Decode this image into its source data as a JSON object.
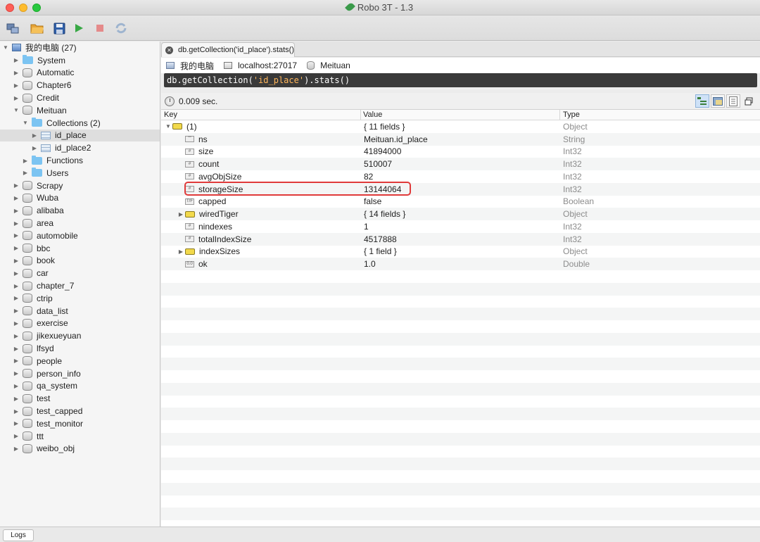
{
  "window": {
    "title": "Robo 3T - 1.3"
  },
  "toolbar": {
    "buttons": [
      "connect-icon",
      "open-icon",
      "save-icon",
      "execute-icon",
      "stop-icon",
      "rotate-icon"
    ]
  },
  "tree": {
    "root_label": "我的电脑 (27)",
    "items": [
      {
        "label": "System",
        "type": "folder",
        "level": 1,
        "expanded": false
      },
      {
        "label": "Automatic",
        "type": "db",
        "level": 1,
        "expanded": false
      },
      {
        "label": "Chapter6",
        "type": "db",
        "level": 1,
        "expanded": false
      },
      {
        "label": "Credit",
        "type": "db",
        "level": 1,
        "expanded": false
      },
      {
        "label": "Meituan",
        "type": "db",
        "level": 1,
        "expanded": true
      },
      {
        "label": "Collections (2)",
        "type": "folder",
        "level": 2,
        "expanded": true
      },
      {
        "label": "id_place",
        "type": "table",
        "level": 3,
        "expanded": false,
        "selected": true
      },
      {
        "label": "id_place2",
        "type": "table",
        "level": 3,
        "expanded": false
      },
      {
        "label": "Functions",
        "type": "folder",
        "level": 2,
        "expanded": false
      },
      {
        "label": "Users",
        "type": "folder",
        "level": 2,
        "expanded": false
      },
      {
        "label": "Scrapy",
        "type": "db",
        "level": 1,
        "expanded": false
      },
      {
        "label": "Wuba",
        "type": "db",
        "level": 1,
        "expanded": false
      },
      {
        "label": "alibaba",
        "type": "db",
        "level": 1,
        "expanded": false
      },
      {
        "label": "area",
        "type": "db",
        "level": 1,
        "expanded": false
      },
      {
        "label": "automobile",
        "type": "db",
        "level": 1,
        "expanded": false
      },
      {
        "label": "bbc",
        "type": "db",
        "level": 1,
        "expanded": false
      },
      {
        "label": "book",
        "type": "db",
        "level": 1,
        "expanded": false
      },
      {
        "label": "car",
        "type": "db",
        "level": 1,
        "expanded": false
      },
      {
        "label": "chapter_7",
        "type": "db",
        "level": 1,
        "expanded": false
      },
      {
        "label": "ctrip",
        "type": "db",
        "level": 1,
        "expanded": false
      },
      {
        "label": "data_list",
        "type": "db",
        "level": 1,
        "expanded": false
      },
      {
        "label": "exercise",
        "type": "db",
        "level": 1,
        "expanded": false
      },
      {
        "label": "jikexueyuan",
        "type": "db",
        "level": 1,
        "expanded": false
      },
      {
        "label": "lfsyd",
        "type": "db",
        "level": 1,
        "expanded": false
      },
      {
        "label": "people",
        "type": "db",
        "level": 1,
        "expanded": false
      },
      {
        "label": "person_info",
        "type": "db",
        "level": 1,
        "expanded": false
      },
      {
        "label": "qa_system",
        "type": "db",
        "level": 1,
        "expanded": false
      },
      {
        "label": "test",
        "type": "db",
        "level": 1,
        "expanded": false
      },
      {
        "label": "test_capped",
        "type": "db",
        "level": 1,
        "expanded": false
      },
      {
        "label": "test_monitor",
        "type": "db",
        "level": 1,
        "expanded": false
      },
      {
        "label": "ttt",
        "type": "db",
        "level": 1,
        "expanded": false
      },
      {
        "label": "weibo_obj",
        "type": "db",
        "level": 1,
        "expanded": false
      }
    ]
  },
  "tab": {
    "label": "db.getCollection('id_place').stats()"
  },
  "connection": {
    "computer": "我的电脑",
    "host": "localhost:27017",
    "database": "Meituan"
  },
  "query": {
    "prefix": "db.getCollection(",
    "string": "'id_place'",
    "suffix": ").stats()"
  },
  "result": {
    "time": "0.009 sec."
  },
  "grid": {
    "headers": {
      "key": "Key",
      "value": "Value",
      "type": "Type"
    },
    "rows": [
      {
        "key": "(1)",
        "value": "{ 11 fields }",
        "type": "Object",
        "indent": 0,
        "icon": "object",
        "arrow": "expanded"
      },
      {
        "key": "ns",
        "value": "Meituan.id_place",
        "type": "String",
        "indent": 1,
        "icon": "string",
        "arrow": "none"
      },
      {
        "key": "size",
        "value": "41894000",
        "type": "Int32",
        "indent": 1,
        "icon": "number",
        "arrow": "none"
      },
      {
        "key": "count",
        "value": "510007",
        "type": "Int32",
        "indent": 1,
        "icon": "number",
        "arrow": "none"
      },
      {
        "key": "avgObjSize",
        "value": "82",
        "type": "Int32",
        "indent": 1,
        "icon": "number",
        "arrow": "none"
      },
      {
        "key": "storageSize",
        "value": "13144064",
        "type": "Int32",
        "indent": 1,
        "icon": "number",
        "arrow": "none"
      },
      {
        "key": "capped",
        "value": "false",
        "type": "Boolean",
        "indent": 1,
        "icon": "boolean",
        "arrow": "none"
      },
      {
        "key": "wiredTiger",
        "value": "{ 14 fields }",
        "type": "Object",
        "indent": 1,
        "icon": "object",
        "arrow": "collapsed"
      },
      {
        "key": "nindexes",
        "value": "1",
        "type": "Int32",
        "indent": 1,
        "icon": "number",
        "arrow": "none"
      },
      {
        "key": "totalIndexSize",
        "value": "4517888",
        "type": "Int32",
        "indent": 1,
        "icon": "number",
        "arrow": "none"
      },
      {
        "key": "indexSizes",
        "value": "{ 1 field }",
        "type": "Object",
        "indent": 1,
        "icon": "object",
        "arrow": "collapsed"
      },
      {
        "key": "ok",
        "value": "1.0",
        "type": "Double",
        "indent": 1,
        "icon": "double",
        "arrow": "none"
      }
    ]
  },
  "statusbar": {
    "logs_label": "Logs"
  }
}
